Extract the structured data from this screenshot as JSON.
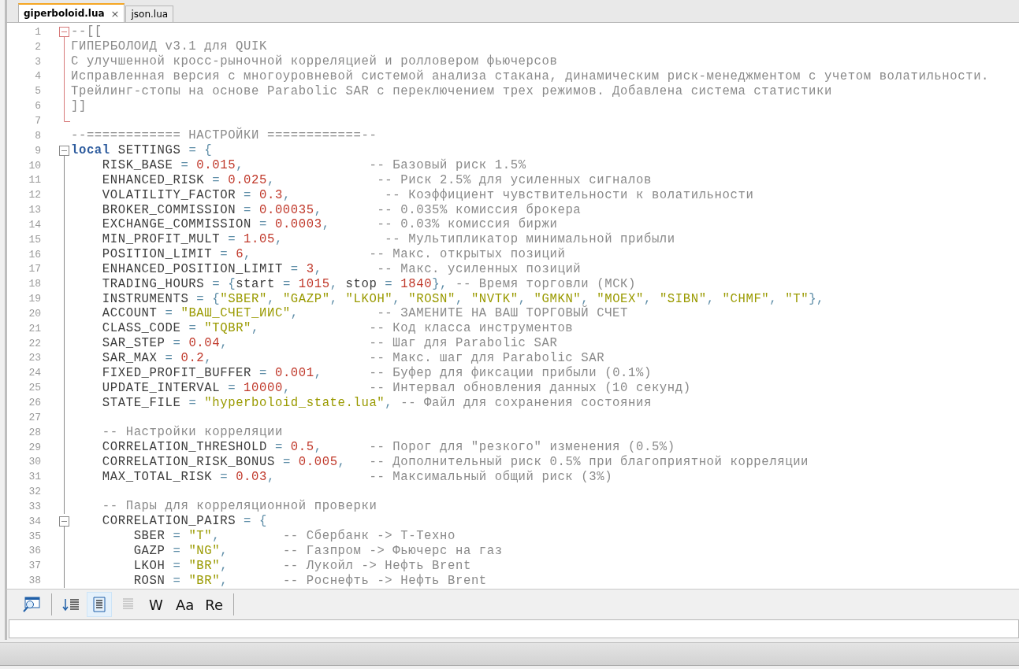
{
  "tabs": [
    {
      "label": "giperboloid.lua",
      "selected": true,
      "close": "×"
    },
    {
      "label": "json.lua",
      "selected": false
    }
  ],
  "editor": {
    "lines": [
      {
        "number": "1",
        "kind": "fold-start",
        "color": "#d77a7a",
        "tokens": [
          {
            "kind": "comment",
            "text": "--[["
          }
        ]
      },
      {
        "number": "2",
        "kind": "fold-body",
        "color": "#d77a7a",
        "tokens": [
          {
            "kind": "comment",
            "text": "ГИПЕРБОЛОИД v3.1 для QUIK"
          }
        ]
      },
      {
        "number": "3",
        "kind": "fold-body",
        "color": "#d77a7a",
        "tokens": [
          {
            "kind": "comment",
            "text": "С улучшенной кросс-рыночной корреляцией и ролловером фьючерсов"
          }
        ]
      },
      {
        "number": "4",
        "kind": "fold-body",
        "color": "#d77a7a",
        "tokens": [
          {
            "kind": "comment",
            "text": "Исправленная версия с многоуровневой системой анализа стакана, динамическим риск-менеджментом с учетом волатильности."
          }
        ]
      },
      {
        "number": "5",
        "kind": "fold-body",
        "color": "#d77a7a",
        "tokens": [
          {
            "kind": "comment",
            "text": "Трейлинг-стопы на основе Parabolic SAR с переключением трех режимов. Добавлена система статистики"
          }
        ]
      },
      {
        "number": "6",
        "kind": "fold-body",
        "color": "#d77a7a",
        "tokens": [
          {
            "kind": "comment",
            "text": "]]"
          }
        ]
      },
      {
        "number": "7",
        "kind": "fold-end",
        "color": "#d77a7a"
      },
      {
        "number": "8",
        "kind": "plain",
        "tokens": [
          {
            "kind": "comment",
            "text": "--============ НАСТРОЙКИ ============--"
          }
        ]
      },
      {
        "number": "9",
        "kind": "fold-start",
        "color": "#8a8a8a",
        "tokens": [
          {
            "kind": "keyword",
            "text": "local"
          },
          {
            "kind": "plain",
            "text": " SETTINGS "
          },
          {
            "kind": "op",
            "text": "= {"
          }
        ]
      },
      {
        "number": "10",
        "kind": "fold-body",
        "color": "#8a8a8a",
        "tokens": [
          {
            "kind": "plain",
            "text": "    RISK_BASE "
          },
          {
            "kind": "op",
            "text": "= "
          },
          {
            "kind": "number",
            "text": "0.015"
          },
          {
            "kind": "op",
            "text": ",                "
          },
          {
            "kind": "comment",
            "text": "-- Базовый риск 1.5%"
          }
        ]
      },
      {
        "number": "11",
        "kind": "fold-body",
        "color": "#8a8a8a",
        "tokens": [
          {
            "kind": "plain",
            "text": "    ENHANCED_RISK "
          },
          {
            "kind": "op",
            "text": "= "
          },
          {
            "kind": "number",
            "text": "0.025"
          },
          {
            "kind": "op",
            "text": ",             "
          },
          {
            "kind": "comment",
            "text": "-- Риск 2.5% для усиленных сигналов"
          }
        ]
      },
      {
        "number": "12",
        "kind": "fold-body",
        "color": "#8a8a8a",
        "tokens": [
          {
            "kind": "plain",
            "text": "    VOLATILITY_FACTOR "
          },
          {
            "kind": "op",
            "text": "= "
          },
          {
            "kind": "number",
            "text": "0.3"
          },
          {
            "kind": "op",
            "text": ",            "
          },
          {
            "kind": "comment",
            "text": "-- Коэффициент чувствительности к волатильности"
          }
        ]
      },
      {
        "number": "13",
        "kind": "fold-body",
        "color": "#8a8a8a",
        "tokens": [
          {
            "kind": "plain",
            "text": "    BROKER_COMMISSION "
          },
          {
            "kind": "op",
            "text": "= "
          },
          {
            "kind": "number",
            "text": "0.00035"
          },
          {
            "kind": "op",
            "text": ",       "
          },
          {
            "kind": "comment",
            "text": "-- 0.035% комиссия брокера"
          }
        ]
      },
      {
        "number": "14",
        "kind": "fold-body",
        "color": "#8a8a8a",
        "tokens": [
          {
            "kind": "plain",
            "text": "    EXCHANGE_COMMISSION "
          },
          {
            "kind": "op",
            "text": "= "
          },
          {
            "kind": "number",
            "text": "0.0003"
          },
          {
            "kind": "op",
            "text": ",      "
          },
          {
            "kind": "comment",
            "text": "-- 0.03% комиссия биржи"
          }
        ]
      },
      {
        "number": "15",
        "kind": "fold-body",
        "color": "#8a8a8a",
        "tokens": [
          {
            "kind": "plain",
            "text": "    MIN_PROFIT_MULT "
          },
          {
            "kind": "op",
            "text": "= "
          },
          {
            "kind": "number",
            "text": "1.05"
          },
          {
            "kind": "op",
            "text": ",             "
          },
          {
            "kind": "comment",
            "text": "-- Мультипликатор минимальной прибыли"
          }
        ]
      },
      {
        "number": "16",
        "kind": "fold-body",
        "color": "#8a8a8a",
        "tokens": [
          {
            "kind": "plain",
            "text": "    POSITION_LIMIT "
          },
          {
            "kind": "op",
            "text": "= "
          },
          {
            "kind": "number",
            "text": "6"
          },
          {
            "kind": "op",
            "text": ",               "
          },
          {
            "kind": "comment",
            "text": "-- Макс. открытых позиций"
          }
        ]
      },
      {
        "number": "17",
        "kind": "fold-body",
        "color": "#8a8a8a",
        "tokens": [
          {
            "kind": "plain",
            "text": "    ENHANCED_POSITION_LIMIT "
          },
          {
            "kind": "op",
            "text": "= "
          },
          {
            "kind": "number",
            "text": "3"
          },
          {
            "kind": "op",
            "text": ",       "
          },
          {
            "kind": "comment",
            "text": "-- Макс. усиленных позиций"
          }
        ]
      },
      {
        "number": "18",
        "kind": "fold-body",
        "color": "#8a8a8a",
        "tokens": [
          {
            "kind": "plain",
            "text": "    TRADING_HOURS "
          },
          {
            "kind": "op",
            "text": "= {"
          },
          {
            "kind": "plain",
            "text": "start "
          },
          {
            "kind": "op",
            "text": "= "
          },
          {
            "kind": "number",
            "text": "1015"
          },
          {
            "kind": "op",
            "text": ", "
          },
          {
            "kind": "plain",
            "text": "stop "
          },
          {
            "kind": "op",
            "text": "= "
          },
          {
            "kind": "number",
            "text": "1840"
          },
          {
            "kind": "op",
            "text": "}, "
          },
          {
            "kind": "comment",
            "text": "-- Время торговли (МСК)"
          }
        ]
      },
      {
        "number": "19",
        "kind": "fold-body",
        "color": "#8a8a8a",
        "tokens": [
          {
            "kind": "plain",
            "text": "    INSTRUMENTS "
          },
          {
            "kind": "op",
            "text": "= {"
          },
          {
            "kind": "string",
            "text": "\"SBER\""
          },
          {
            "kind": "op",
            "text": ", "
          },
          {
            "kind": "string",
            "text": "\"GAZP\""
          },
          {
            "kind": "op",
            "text": ", "
          },
          {
            "kind": "string",
            "text": "\"LKOH\""
          },
          {
            "kind": "op",
            "text": ", "
          },
          {
            "kind": "string",
            "text": "\"ROSN\""
          },
          {
            "kind": "op",
            "text": ", "
          },
          {
            "kind": "string",
            "text": "\"NVTK\""
          },
          {
            "kind": "op",
            "text": ", "
          },
          {
            "kind": "string",
            "text": "\"GMKN\""
          },
          {
            "kind": "op",
            "text": ", "
          },
          {
            "kind": "string",
            "text": "\"MOEX\""
          },
          {
            "kind": "op",
            "text": ", "
          },
          {
            "kind": "string",
            "text": "\"SIBN\""
          },
          {
            "kind": "op",
            "text": ", "
          },
          {
            "kind": "string",
            "text": "\"CHMF\""
          },
          {
            "kind": "op",
            "text": ", "
          },
          {
            "kind": "string",
            "text": "\"T\""
          },
          {
            "kind": "op",
            "text": "},"
          }
        ]
      },
      {
        "number": "20",
        "kind": "fold-body",
        "color": "#8a8a8a",
        "tokens": [
          {
            "kind": "plain",
            "text": "    ACCOUNT "
          },
          {
            "kind": "op",
            "text": "= "
          },
          {
            "kind": "string",
            "text": "\"ВАШ_СЧЕТ_ИИС\""
          },
          {
            "kind": "op",
            "text": ",          "
          },
          {
            "kind": "comment",
            "text": "-- ЗАМЕНИТЕ НА ВАШ ТОРГОВЫЙ СЧЕТ"
          }
        ]
      },
      {
        "number": "21",
        "kind": "fold-body",
        "color": "#8a8a8a",
        "tokens": [
          {
            "kind": "plain",
            "text": "    CLASS_CODE "
          },
          {
            "kind": "op",
            "text": "= "
          },
          {
            "kind": "string",
            "text": "\"TQBR\""
          },
          {
            "kind": "op",
            "text": ",              "
          },
          {
            "kind": "comment",
            "text": "-- Код класса инструментов"
          }
        ]
      },
      {
        "number": "22",
        "kind": "fold-body",
        "color": "#8a8a8a",
        "tokens": [
          {
            "kind": "plain",
            "text": "    SAR_STEP "
          },
          {
            "kind": "op",
            "text": "= "
          },
          {
            "kind": "number",
            "text": "0.04"
          },
          {
            "kind": "op",
            "text": ",                  "
          },
          {
            "kind": "comment",
            "text": "-- Шаг для Parabolic SAR"
          }
        ]
      },
      {
        "number": "23",
        "kind": "fold-body",
        "color": "#8a8a8a",
        "tokens": [
          {
            "kind": "plain",
            "text": "    SAR_MAX "
          },
          {
            "kind": "op",
            "text": "= "
          },
          {
            "kind": "number",
            "text": "0.2"
          },
          {
            "kind": "op",
            "text": ",                    "
          },
          {
            "kind": "comment",
            "text": "-- Макс. шаг для Parabolic SAR"
          }
        ]
      },
      {
        "number": "24",
        "kind": "fold-body",
        "color": "#8a8a8a",
        "tokens": [
          {
            "kind": "plain",
            "text": "    FIXED_PROFIT_BUFFER "
          },
          {
            "kind": "op",
            "text": "= "
          },
          {
            "kind": "number",
            "text": "0.001"
          },
          {
            "kind": "op",
            "text": ",      "
          },
          {
            "kind": "comment",
            "text": "-- Буфер для фиксации прибыли (0.1%)"
          }
        ]
      },
      {
        "number": "25",
        "kind": "fold-body",
        "color": "#8a8a8a",
        "tokens": [
          {
            "kind": "plain",
            "text": "    UPDATE_INTERVAL "
          },
          {
            "kind": "op",
            "text": "= "
          },
          {
            "kind": "number",
            "text": "10000"
          },
          {
            "kind": "op",
            "text": ",          "
          },
          {
            "kind": "comment",
            "text": "-- Интервал обновления данных (10 секунд)"
          }
        ]
      },
      {
        "number": "26",
        "kind": "fold-body",
        "color": "#8a8a8a",
        "tokens": [
          {
            "kind": "plain",
            "text": "    STATE_FILE "
          },
          {
            "kind": "op",
            "text": "= "
          },
          {
            "kind": "string",
            "text": "\"hyperboloid_state.lua\""
          },
          {
            "kind": "op",
            "text": ", "
          },
          {
            "kind": "comment",
            "text": "-- Файл для сохранения состояния"
          }
        ]
      },
      {
        "number": "27",
        "kind": "fold-body",
        "color": "#8a8a8a"
      },
      {
        "number": "28",
        "kind": "fold-body",
        "color": "#8a8a8a",
        "tokens": [
          {
            "kind": "comment",
            "text": "    -- Настройки корреляции"
          }
        ]
      },
      {
        "number": "29",
        "kind": "fold-body",
        "color": "#8a8a8a",
        "tokens": [
          {
            "kind": "plain",
            "text": "    CORRELATION_THRESHOLD "
          },
          {
            "kind": "op",
            "text": "= "
          },
          {
            "kind": "number",
            "text": "0.5"
          },
          {
            "kind": "op",
            "text": ",      "
          },
          {
            "kind": "comment",
            "text": "-- Порог для \"резкого\" изменения (0.5%)"
          }
        ]
      },
      {
        "number": "30",
        "kind": "fold-body",
        "color": "#8a8a8a",
        "tokens": [
          {
            "kind": "plain",
            "text": "    CORRELATION_RISK_BONUS "
          },
          {
            "kind": "op",
            "text": "= "
          },
          {
            "kind": "number",
            "text": "0.005"
          },
          {
            "kind": "op",
            "text": ",   "
          },
          {
            "kind": "comment",
            "text": "-- Дополнительный риск 0.5% при благоприятной корреляции"
          }
        ]
      },
      {
        "number": "31",
        "kind": "fold-body",
        "color": "#8a8a8a",
        "tokens": [
          {
            "kind": "plain",
            "text": "    MAX_TOTAL_RISK "
          },
          {
            "kind": "op",
            "text": "= "
          },
          {
            "kind": "number",
            "text": "0.03"
          },
          {
            "kind": "op",
            "text": ",            "
          },
          {
            "kind": "comment",
            "text": "-- Максимальный общий риск (3%)"
          }
        ]
      },
      {
        "number": "32",
        "kind": "fold-body",
        "color": "#8a8a8a"
      },
      {
        "number": "33",
        "kind": "fold-body",
        "color": "#8a8a8a",
        "tokens": [
          {
            "kind": "comment",
            "text": "    -- Пары для корреляционной проверки"
          }
        ]
      },
      {
        "number": "34",
        "kind": "fold-start",
        "color": "#8a8a8a",
        "tokens": [
          {
            "kind": "plain",
            "text": "    CORRELATION_PAIRS "
          },
          {
            "kind": "op",
            "text": "= {"
          }
        ]
      },
      {
        "number": "35",
        "kind": "fold-body",
        "color": "#8a8a8a",
        "tokens": [
          {
            "kind": "plain",
            "text": "        SBER "
          },
          {
            "kind": "op",
            "text": "= "
          },
          {
            "kind": "string",
            "text": "\"T\""
          },
          {
            "kind": "op",
            "text": ",        "
          },
          {
            "kind": "comment",
            "text": "-- Сбербанк -> Т-Техно"
          }
        ]
      },
      {
        "number": "36",
        "kind": "fold-body",
        "color": "#8a8a8a",
        "tokens": [
          {
            "kind": "plain",
            "text": "        GAZP "
          },
          {
            "kind": "op",
            "text": "= "
          },
          {
            "kind": "string",
            "text": "\"NG\""
          },
          {
            "kind": "op",
            "text": ",       "
          },
          {
            "kind": "comment",
            "text": "-- Газпром -> Фьючерс на газ"
          }
        ]
      },
      {
        "number": "37",
        "kind": "fold-body",
        "color": "#8a8a8a",
        "tokens": [
          {
            "kind": "plain",
            "text": "        LKOH "
          },
          {
            "kind": "op",
            "text": "= "
          },
          {
            "kind": "string",
            "text": "\"BR\""
          },
          {
            "kind": "op",
            "text": ",       "
          },
          {
            "kind": "comment",
            "text": "-- Лукойл -> Нефть Brent"
          }
        ]
      },
      {
        "number": "38",
        "kind": "fold-body",
        "color": "#8a8a8a",
        "tokens": [
          {
            "kind": "plain",
            "text": "        ROSN "
          },
          {
            "kind": "op",
            "text": "= "
          },
          {
            "kind": "string",
            "text": "\"BR\""
          },
          {
            "kind": "op",
            "text": ",       "
          },
          {
            "kind": "comment",
            "text": "-- Роснефть -> Нефть Brent"
          }
        ]
      }
    ]
  },
  "search_toolbar": {
    "buttons": [
      {
        "kind": "find",
        "selected": false,
        "disabled": false
      },
      {
        "kind": "sort",
        "selected": false,
        "disabled": false
      },
      {
        "kind": "wrap",
        "selected": true,
        "disabled": false
      },
      {
        "kind": "list",
        "selected": false,
        "disabled": true
      },
      {
        "kind": "text",
        "label": "W",
        "selected": false,
        "disabled": false
      },
      {
        "kind": "text",
        "label": "Aa",
        "selected": false,
        "disabled": false
      },
      {
        "kind": "text",
        "label": "Re",
        "selected": false,
        "disabled": false
      }
    ]
  }
}
